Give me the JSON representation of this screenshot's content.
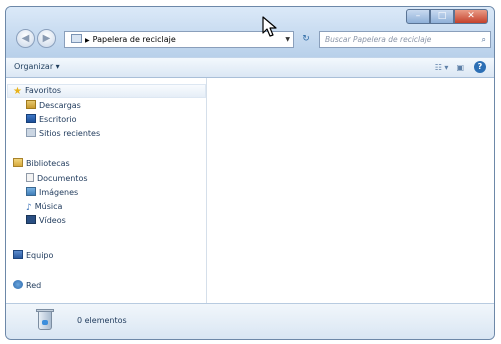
{
  "window": {
    "address": {
      "crumb": "Papelera de reciclaje"
    },
    "search": {
      "placeholder": "Buscar Papelera de reciclaje"
    },
    "controls": {
      "minimize": "–",
      "maximize": "□",
      "close": "✕"
    }
  },
  "toolbar": {
    "organize_label": "Organizar ▾"
  },
  "nav": {
    "favorites": {
      "label": "Favoritos",
      "items": [
        "Descargas",
        "Escritorio",
        "Sitios recientes"
      ]
    },
    "libraries": {
      "label": "Bibliotecas",
      "items": [
        "Documentos",
        "Imágenes",
        "Música",
        "Vídeos"
      ]
    },
    "computer": "Equipo",
    "network": "Red"
  },
  "details": {
    "item_count": "0 elementos"
  },
  "colors": {
    "frame": "#c7dbf0",
    "accent": "#2c6fb5",
    "text": "#1e395b"
  }
}
